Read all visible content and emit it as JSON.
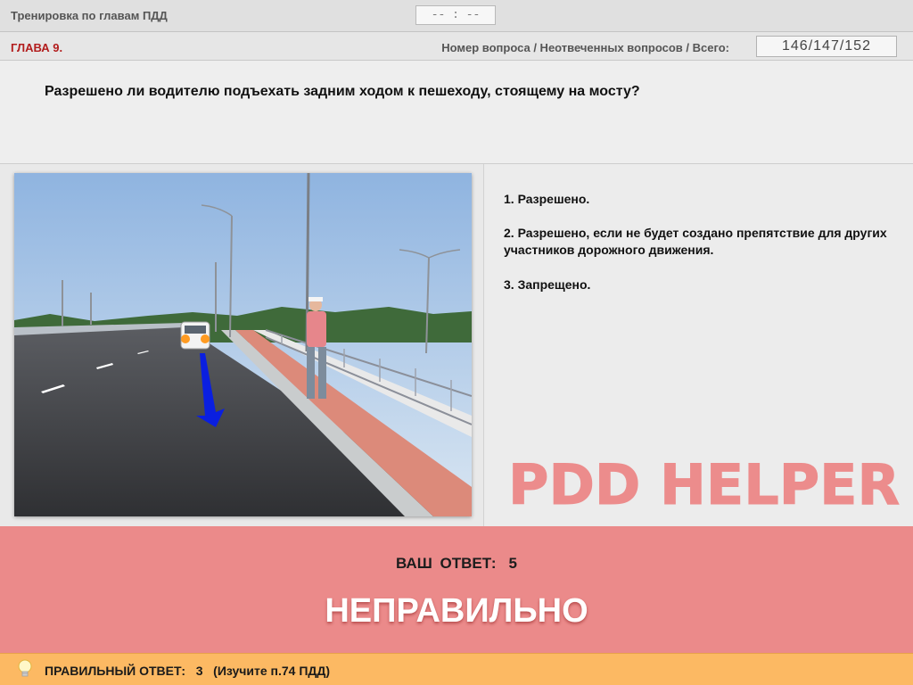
{
  "header": {
    "title": "Тренировка по главам ПДД",
    "timer": "-- : --"
  },
  "info": {
    "chapter": "ГЛАВА 9.",
    "counter_label": "Номер вопроса / Неотвеченных вопросов / Всего:",
    "counter": "146/147/152"
  },
  "question": {
    "text": "Разрешено ли водителю подъехать задним ходом к пешеходу, стоящему на мосту?"
  },
  "answers": [
    {
      "label": "1.  Разрешено."
    },
    {
      "label": "2.  Разрешено, если не будет создано препятствие для других участников дорожного движения."
    },
    {
      "label": "3.  Запрещено."
    }
  ],
  "watermark": "PDD HELPER",
  "result": {
    "your_answer_label": "ВАШ ОТВЕТ:",
    "your_answer_value": "5",
    "verdict": "НЕПРАВИЛЬНО"
  },
  "hint": {
    "text": "ПРАВИЛЬНЫЙ ОТВЕТ:   3   (Изучите п.74 ПДД)",
    "icon": "lightbulb-icon"
  },
  "colors": {
    "chapter": "#b21c1c",
    "result_bg": "#eb8a8a",
    "hint_bg": "#fcb963",
    "watermark": "#ec8c8c"
  }
}
